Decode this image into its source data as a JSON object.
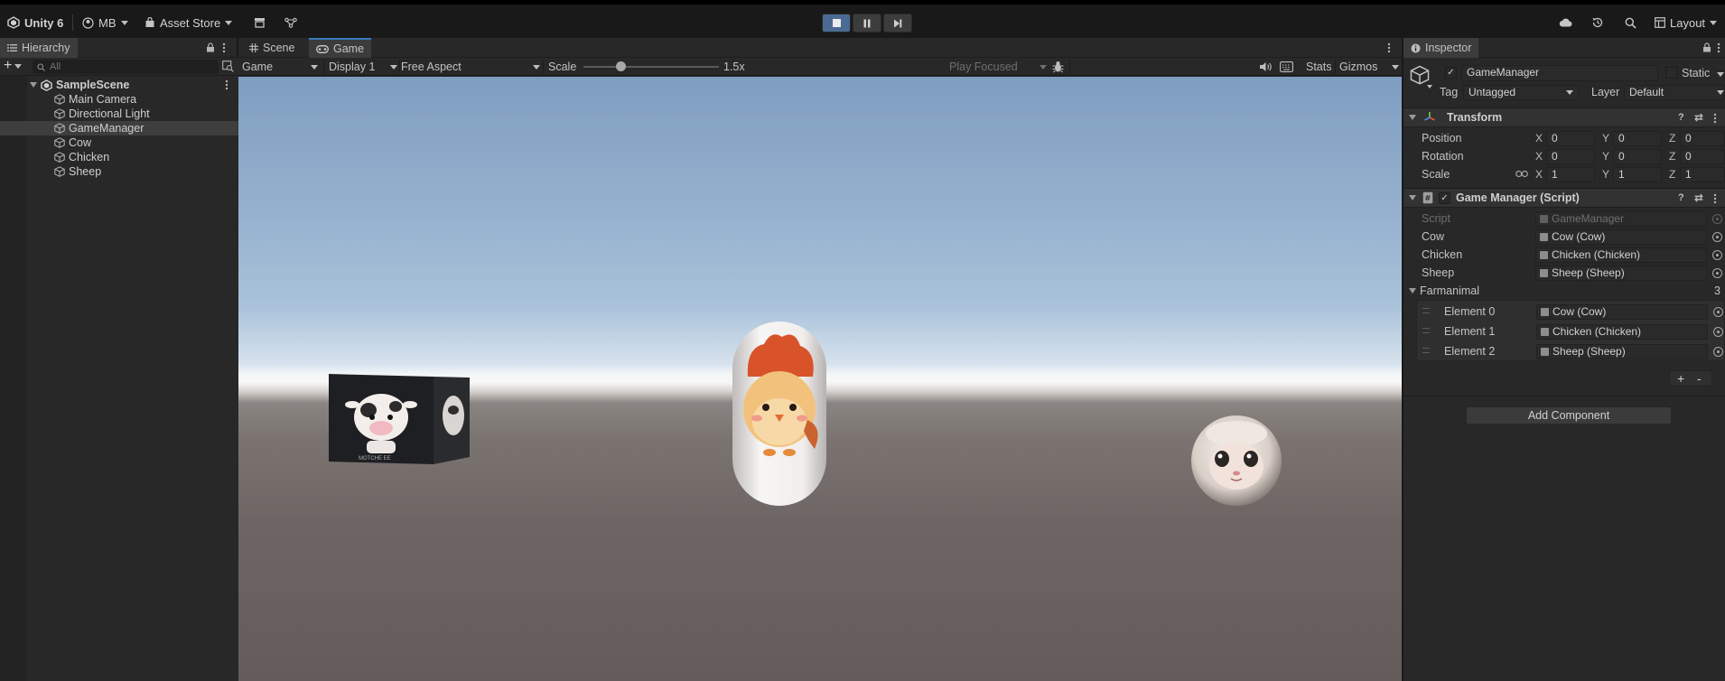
{
  "topbar": {
    "app_name": "Unity 6",
    "account": "MB",
    "asset_store": "Asset Store",
    "layout": "Layout"
  },
  "hierarchy": {
    "tab_label": "Hierarchy",
    "search_placeholder": "All",
    "scene": "SampleScene",
    "items": [
      "Main Camera",
      "Directional Light",
      "GameManager",
      "Cow",
      "Chicken",
      "Sheep"
    ],
    "selected": "GameManager"
  },
  "game": {
    "tabs": [
      "Scene",
      "Game"
    ],
    "active_tab": "Game",
    "view_select": "Game",
    "display": "Display 1",
    "aspect": "Free Aspect",
    "scale_label": "Scale",
    "scale_value": "1.5x",
    "scale_fraction": 0.27,
    "play_focused": "Play Focused",
    "stats": "Stats",
    "gizmos": "Gizmos",
    "cube_caption": "MOTCHE EE"
  },
  "inspector": {
    "tab_label": "Inspector",
    "object_name": "GameManager",
    "static_label": "Static",
    "tag_label": "Tag",
    "tag_value": "Untagged",
    "layer_label": "Layer",
    "layer_value": "Default",
    "transform": {
      "title": "Transform",
      "rows": [
        {
          "label": "Position",
          "x": "0",
          "y": "0",
          "z": "0"
        },
        {
          "label": "Rotation",
          "x": "0",
          "y": "0",
          "z": "0"
        },
        {
          "label": "Scale",
          "x": "1",
          "y": "1",
          "z": "1"
        }
      ]
    },
    "script_component": {
      "title": "Game Manager (Script)",
      "script_label": "Script",
      "script_value": "GameManager",
      "fields": [
        {
          "label": "Cow",
          "value": "Cow (Cow)"
        },
        {
          "label": "Chicken",
          "value": "Chicken (Chicken)"
        },
        {
          "label": "Sheep",
          "value": "Sheep (Sheep)"
        }
      ],
      "list_label": "Farmanimal",
      "list_count": "3",
      "elements": [
        {
          "label": "Element 0",
          "value": "Cow (Cow)"
        },
        {
          "label": "Element 1",
          "value": "Chicken (Chicken)"
        },
        {
          "label": "Element 2",
          "value": "Sheep (Sheep)"
        }
      ],
      "add_symbol": "+",
      "remove_symbol": "-"
    },
    "add_component": "Add Component"
  },
  "colors": {
    "accent": "#3a79bb",
    "play_active": "#4a6a93",
    "panel_bg": "#282828"
  }
}
